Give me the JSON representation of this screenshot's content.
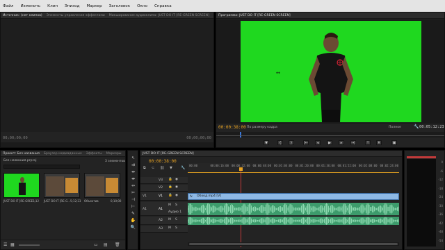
{
  "menu": {
    "items": [
      "Файл",
      "Изменить",
      "Клип",
      "Эпизод",
      "Маркер",
      "Заголовок",
      "Окно",
      "Справка"
    ]
  },
  "source_panel": {
    "tabs": [
      "Источник: (нет клипов)",
      "Элементы управления эффектами",
      "Микширование аудиоклипа: JUST DO IT [RE-GREEN SCREEN]"
    ],
    "timecode_left": "00;00;00;00",
    "timecode_right": "00;00;00;00"
  },
  "program_panel": {
    "tab": "Программа: JUST DO IT [RE-GREEN SCREEN]",
    "timecode_current": "00:00:38:00",
    "fit_label": "По размеру кадра",
    "quality_label": "Полное",
    "timecode_duration": "00:05:12:23",
    "colors": {
      "green_screen": "#1fd81f",
      "accent": "#e8a323"
    }
  },
  "project_panel": {
    "tabs": [
      "Проект: Без названия",
      "Браузер медиаданных",
      "Эффекты",
      "Маркеры"
    ],
    "file_name": "Без названия.prproj",
    "item_count": "3 элементов",
    "items": [
      {
        "name": "JUST DO IT [RE-GREE...",
        "duration": "5;12"
      },
      {
        "name": "JUST DO IT [RE-G...",
        "duration": "5;12;23"
      },
      {
        "name": "Объектив",
        "duration": "0;10;00"
      }
    ]
  },
  "timeline_panel": {
    "tab": "JUST DO IT [RE-GREEN SCREEN]",
    "timecode": "00:00:38:00",
    "ruler": [
      "00:00",
      "00:00:16:00",
      "00:00:32:00",
      "00:00:48:00",
      "00:01:04:00",
      "00:01:20:00",
      "00:01:36:00",
      "00:01:52:00",
      "00:02:08:00",
      "00:02:24:00"
    ],
    "tracks": {
      "video": [
        "V3",
        "V2",
        "V1"
      ],
      "audio": [
        "A1",
        "A2",
        "A3"
      ],
      "v1_target": "V1",
      "a1_target": "A1",
      "a1_name": "Аудио 1"
    },
    "clip_label": "Обход.mp4 [V]"
  },
  "audio_meter": {
    "ticks": [
      "0",
      "-6",
      "-12",
      "-18",
      "-24",
      "-30",
      "-36",
      "-42",
      "-48",
      "-54"
    ]
  }
}
